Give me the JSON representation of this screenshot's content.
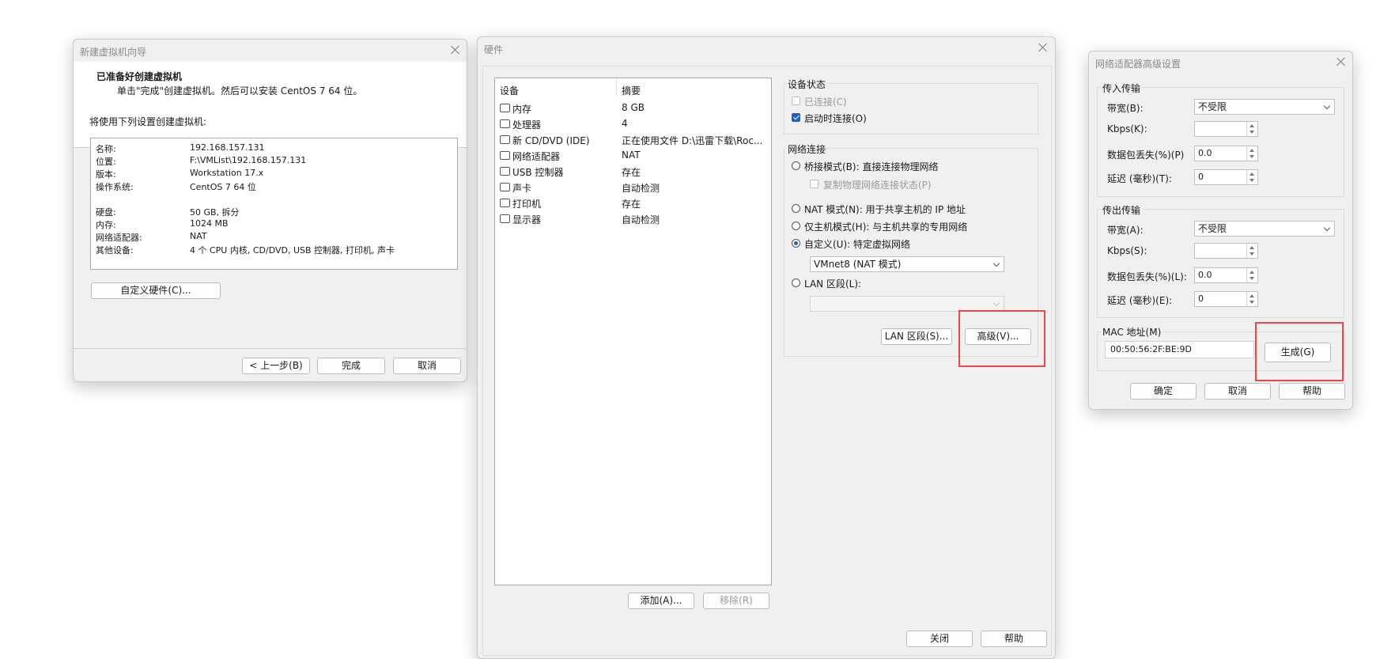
{
  "wizard": {
    "title": "新建虚拟机向导",
    "heading": "已准备好创建虚拟机",
    "subheading": "单击\"完成\"创建虚拟机。然后可以安装 CentOS 7 64 位。",
    "intro": "将使用下列设置创建虚拟机:",
    "settings": [
      {
        "label": "名称:",
        "value": "192.168.157.131"
      },
      {
        "label": "位置:",
        "value": "F:\\VMList\\192.168.157.131"
      },
      {
        "label": "版本:",
        "value": "Workstation 17.x"
      },
      {
        "label": "操作系统:",
        "value": "CentOS 7 64 位"
      },
      {
        "label": "硬盘:",
        "value": "50 GB, 拆分"
      },
      {
        "label": "内存:",
        "value": "1024 MB"
      },
      {
        "label": "网络适配器:",
        "value": "NAT"
      },
      {
        "label": "其他设备:",
        "value": "4 个 CPU 内核, CD/DVD, USB 控制器, 打印机, 声卡"
      }
    ],
    "customize_button": "自定义硬件(C)...",
    "back_button": "< 上一步(B)",
    "finish_button": "完成",
    "cancel_button": "取消"
  },
  "hardware": {
    "title": "硬件",
    "col_device": "设备",
    "col_summary": "摘要",
    "devices": [
      {
        "icon": "memory-icon",
        "name": "内存",
        "summary": "8 GB"
      },
      {
        "icon": "processor-icon",
        "name": "处理器",
        "summary": "4"
      },
      {
        "icon": "cd-dvd-icon",
        "name": "新 CD/DVD (IDE)",
        "summary": "正在使用文件 D:\\迅雷下载\\Roc..."
      },
      {
        "icon": "network-adapter-icon",
        "name": "网络适配器",
        "summary": "NAT"
      },
      {
        "icon": "usb-icon",
        "name": "USB 控制器",
        "summary": "存在"
      },
      {
        "icon": "sound-icon",
        "name": "声卡",
        "summary": "自动检测"
      },
      {
        "icon": "printer-icon",
        "name": "打印机",
        "summary": "存在"
      },
      {
        "icon": "display-icon",
        "name": "显示器",
        "summary": "自动检测"
      }
    ],
    "add_button": "添加(A)...",
    "remove_button": "移除(R)",
    "device_status_label": "设备状态",
    "connected_label": "已连接(C)",
    "connect_on_start_label": "启动时连接(O)",
    "network_label": "网络连接",
    "bridged_label": "桥接模式(B): 直接连接物理网络",
    "replicate_label": "复制物理网络连接状态(P)",
    "nat_label": "NAT 模式(N): 用于共享主机的 IP 地址",
    "hostonly_label": "仅主机模式(H): 与主机共享的专用网络",
    "custom_label": "自定义(U): 特定虚拟网络",
    "custom_network_value": "VMnet8 (NAT 模式)",
    "lan_label": "LAN 区段(L):",
    "lan_button": "LAN 区段(S)...",
    "advanced_button": "高级(V)...",
    "close_button": "关闭",
    "help_button": "帮助"
  },
  "advanced": {
    "title": "网络适配器高级设置",
    "incoming_label": "传入传输",
    "in_bandwidth_label": "带宽(B):",
    "in_bandwidth_value": "不受限",
    "in_kbps_label": "Kbps(K):",
    "in_loss_label": "数据包丢失(%)(P)",
    "in_loss_value": "0.0",
    "in_latency_label": "延迟 (毫秒)(T):",
    "in_latency_value": "0",
    "outgoing_label": "传出传输",
    "out_bandwidth_label": "带宽(A):",
    "out_bandwidth_value": "不受限",
    "out_kbps_label": "Kbps(S):",
    "out_loss_label": "数据包丢失(%)(L):",
    "out_loss_value": "0.0",
    "out_latency_label": "延迟 (毫秒)(E):",
    "out_latency_value": "0",
    "mac_label": "MAC 地址(M)",
    "mac_value": "00:50:56:2F:BE:9D",
    "generate_button": "生成(G)",
    "ok_button": "确定",
    "cancel_button": "取消",
    "help_button": "帮助"
  },
  "colors": {
    "highlight": "#e8484a",
    "accent": "#1e5fc0"
  }
}
